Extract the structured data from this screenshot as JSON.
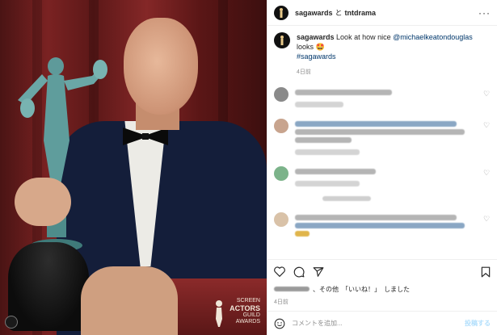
{
  "header": {
    "account": "sagawards",
    "connector": "と",
    "collaborator": "tntdrama",
    "more_icon": "more-horizontal-icon"
  },
  "caption": {
    "username": "sagawards",
    "text": "Look at how nice",
    "mention": "@michaelkeatondouglas",
    "text_after": "looks 🤩",
    "hashtag": "#sagawards",
    "time": "4日前"
  },
  "photo": {
    "logo_lines": [
      "SCREEN",
      "ACTORS",
      "GUILD",
      "AWARDS"
    ]
  },
  "comments": [
    {
      "avatar_color": "#8a8a8a",
      "lines": 2
    },
    {
      "avatar_color": "#c8a48e",
      "lines": 4
    },
    {
      "avatar_color": "#7cb38a",
      "lines": 2
    },
    {
      "avatar_color": "#d9c2a8",
      "lines": 3
    }
  ],
  "actions": {
    "icons": [
      "heart-icon",
      "comment-icon",
      "share-icon",
      "bookmark-icon"
    ]
  },
  "likes": {
    "suffix": "、その他",
    "quoted": "「いいね！」",
    "end": "しました"
  },
  "post_date": "4日前",
  "add_comment": {
    "placeholder": "コメントを追加...",
    "post_label": "投稿する",
    "emoji_icon": "smiley-icon"
  }
}
